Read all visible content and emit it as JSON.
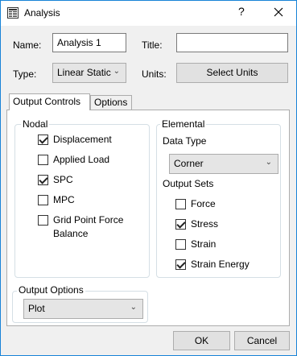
{
  "window": {
    "title": "Analysis",
    "help_label": "?"
  },
  "form": {
    "name_label": "Name:",
    "name_value": "Analysis 1",
    "title_label": "Title:",
    "title_value": "",
    "type_label": "Type:",
    "type_value": "Linear Static",
    "units_label": "Units:",
    "select_units_label": "Select Units"
  },
  "tabs": [
    {
      "label": "Output Controls"
    },
    {
      "label": "Options"
    }
  ],
  "nodal": {
    "title": "Nodal",
    "items": [
      {
        "label": "Displacement",
        "checked": true
      },
      {
        "label": "Applied Load",
        "checked": false
      },
      {
        "label": "SPC",
        "checked": true
      },
      {
        "label": "MPC",
        "checked": false
      },
      {
        "label": "Grid Point Force",
        "label2": "Balance",
        "checked": false
      }
    ]
  },
  "elemental": {
    "title": "Elemental",
    "data_type_label": "Data Type",
    "data_type_value": "Corner",
    "output_sets_label": "Output Sets",
    "items": [
      {
        "label": "Force",
        "checked": false
      },
      {
        "label": "Stress",
        "checked": true
      },
      {
        "label": "Strain",
        "checked": false
      },
      {
        "label": "Strain Energy",
        "checked": true
      }
    ]
  },
  "output_options": {
    "title": "Output Options",
    "value": "Plot"
  },
  "buttons": {
    "ok": "OK",
    "cancel": "Cancel"
  },
  "colors": {
    "window_border": "#1883d7",
    "accent": "#0078d7"
  }
}
